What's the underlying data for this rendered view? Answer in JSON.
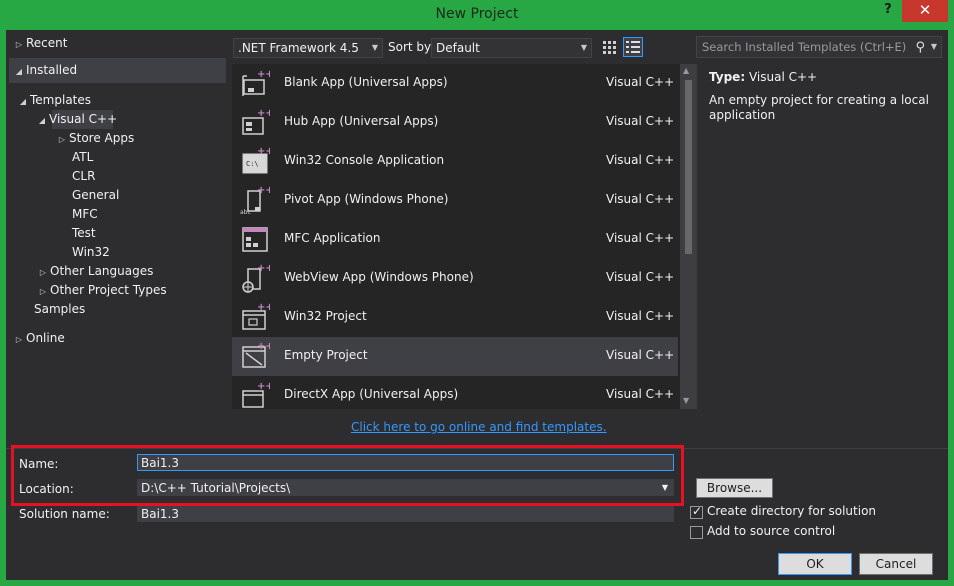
{
  "window": {
    "title": "New Project",
    "help_label": "?",
    "close_label": "✕",
    "accent_color": "#27a844",
    "close_color": "#c7372c"
  },
  "tree": {
    "recent": "Recent",
    "installed": "Installed",
    "templates": "Templates",
    "visual_cpp": "Visual C++",
    "store_apps": "Store Apps",
    "atl": "ATL",
    "clr": "CLR",
    "general": "General",
    "mfc": "MFC",
    "test": "Test",
    "win32": "Win32",
    "other_languages": "Other Languages",
    "other_project_types": "Other Project Types",
    "samples": "Samples",
    "online": "Online"
  },
  "toolbar": {
    "framework": ".NET Framework 4.5",
    "sort_label": "Sort by:",
    "sort_value": "Default",
    "search_placeholder": "Search Installed Templates (Ctrl+E)"
  },
  "templates": [
    {
      "name": "Blank App (Universal Apps)",
      "lang": "Visual C++",
      "icon": "blank-app-icon"
    },
    {
      "name": "Hub App (Universal Apps)",
      "lang": "Visual C++",
      "icon": "hub-app-icon"
    },
    {
      "name": "Win32 Console Application",
      "lang": "Visual C++",
      "icon": "console-app-icon"
    },
    {
      "name": "Pivot App (Windows Phone)",
      "lang": "Visual C++",
      "icon": "pivot-app-icon"
    },
    {
      "name": "MFC Application",
      "lang": "Visual C++",
      "icon": "mfc-app-icon"
    },
    {
      "name": "WebView App (Windows Phone)",
      "lang": "Visual C++",
      "icon": "webview-app-icon"
    },
    {
      "name": "Win32 Project",
      "lang": "Visual C++",
      "icon": "win32-project-icon"
    },
    {
      "name": "Empty Project",
      "lang": "Visual C++",
      "icon": "empty-project-icon"
    },
    {
      "name": "DirectX App (Universal Apps)",
      "lang": "Visual C++",
      "icon": "directx-app-icon"
    }
  ],
  "description": {
    "type_label": "Type:",
    "type_value": "Visual C++",
    "text": "An empty project for creating a local application"
  },
  "online_link": "Click here to go online and find templates.",
  "form": {
    "name_label": "Name:",
    "name_value": "Bai1.3",
    "location_label": "Location:",
    "location_value": "D:\\C++ Tutorial\\Projects\\",
    "solution_label": "Solution name:",
    "solution_value": "Bai1.3",
    "browse_label": "Browse...",
    "create_dir_label": "Create directory for solution",
    "create_dir_checked": true,
    "source_control_label": "Add to source control",
    "source_control_checked": false,
    "ok_label": "OK",
    "cancel_label": "Cancel"
  }
}
